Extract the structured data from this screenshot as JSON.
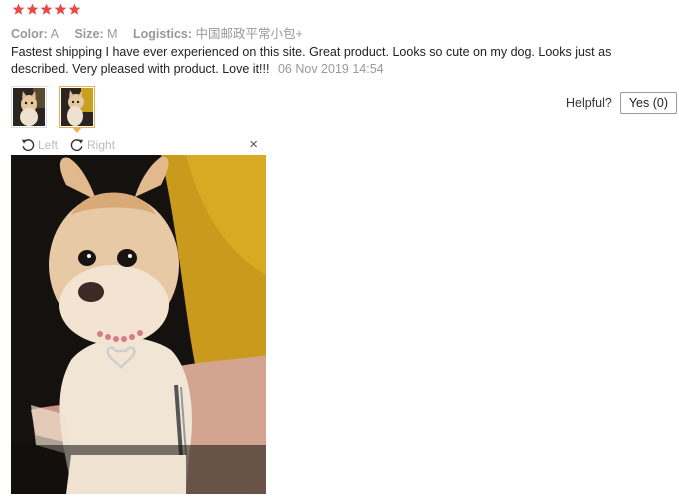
{
  "rating": {
    "stars": 5,
    "color": "#e84a4a"
  },
  "attributes": [
    {
      "label": "Color:",
      "value": "A"
    },
    {
      "label": "Size:",
      "value": "M"
    },
    {
      "label": "Logistics:",
      "value": "中国邮政平常小包+"
    }
  ],
  "review": {
    "text": "Fastest shipping I have ever experienced on this site. Great product. Looks so cute on my dog. Looks just as described. Very pleased with product. Love it!!!",
    "date": "06 Nov 2019 14:54"
  },
  "helpful": {
    "label": "Helpful?",
    "yes_button": "Yes (0)"
  },
  "viewer": {
    "rotate_left": "Left",
    "rotate_right": "Right",
    "close": "×"
  },
  "accent_color": "#f0ad4e"
}
